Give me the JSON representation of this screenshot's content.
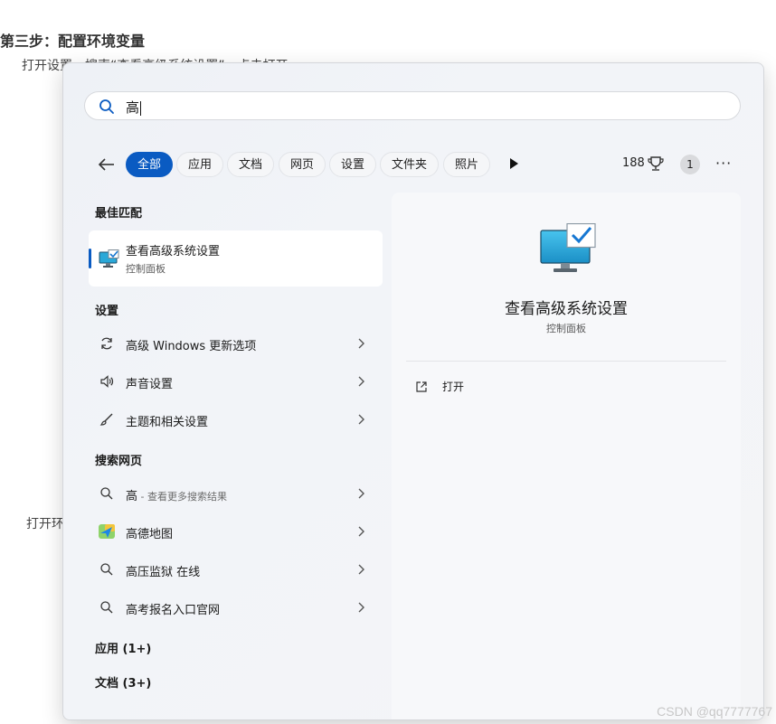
{
  "background": {
    "heading": "第三步：配置环境变量",
    "line1": "打开设置，搜索“查看高级系统设置”，点击打开",
    "line2": "打开环",
    "watermark": "CSDN @qq7777767"
  },
  "search": {
    "query": "高"
  },
  "filters": {
    "tabs": [
      "全部",
      "应用",
      "文档",
      "网页",
      "设置",
      "文件夹",
      "照片"
    ],
    "active_tab": "全部",
    "points": "188",
    "badge_count": "1",
    "more_label": "···"
  },
  "results": {
    "best_match_title": "最佳匹配",
    "best_match": {
      "title": "查看高级系统设置",
      "subtitle": "控制面板",
      "icon": "system-properties-icon"
    },
    "settings_title": "设置",
    "settings": [
      {
        "label": "高级 Windows 更新选项",
        "icon": "refresh-icon"
      },
      {
        "label": "声音设置",
        "icon": "speaker-icon"
      },
      {
        "label": "主题和相关设置",
        "icon": "brush-icon"
      }
    ],
    "web_title": "搜索网页",
    "web": [
      {
        "label": "高",
        "suffix": " - 查看更多搜索结果",
        "icon": "search-icon"
      },
      {
        "label": "高德地图",
        "suffix": "",
        "icon": "map-icon"
      },
      {
        "label": "高压监狱 在线",
        "suffix": "",
        "icon": "search-icon"
      },
      {
        "label": "高考报名入口官网",
        "suffix": "",
        "icon": "search-icon"
      }
    ],
    "apps_title": "应用 (1+)",
    "docs_title": "文档 (3+)"
  },
  "preview": {
    "title": "查看高级系统设置",
    "subtitle": "控制面板",
    "open_label": "打开"
  },
  "colors": {
    "accent": "#0a5bc2",
    "panel_bg": "#f2f4f8"
  }
}
